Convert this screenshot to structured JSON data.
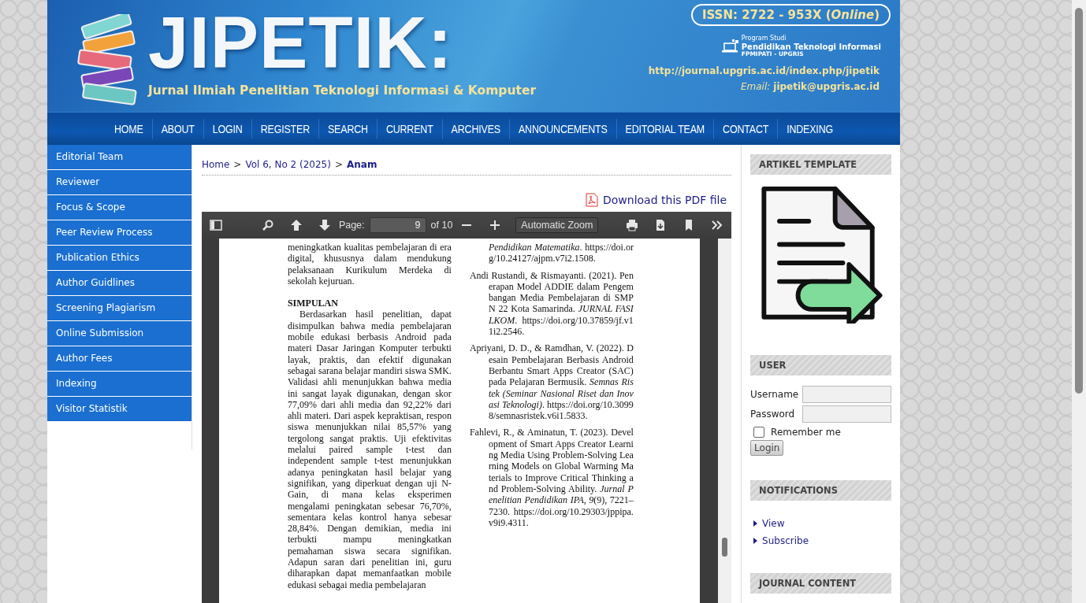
{
  "header": {
    "title": "JIPETIK:",
    "subtitle": "Jurnal Ilmiah Penelitian Teknologi Informasi & Komputer",
    "issn": "ISSN: 2722 - 953X (*Online*)",
    "program_label": "Program Studi",
    "program_name": "Pendidikan Teknologi Informasi",
    "faculty": "FPMIPATI - UPGRIS",
    "url": "http://journal.upgris.ac.id/index.php/jipetik",
    "email_label": "Email:",
    "email": "jipetik@upgris.ac.id"
  },
  "nav": [
    "HOME",
    "ABOUT",
    "LOGIN",
    "REGISTER",
    "SEARCH",
    "CURRENT",
    "ARCHIVES",
    "ANNOUNCEMENTS",
    "EDITORIAL TEAM",
    "CONTACT",
    "INDEXING"
  ],
  "sidebar": {
    "items": [
      "Editorial Team",
      "Reviewer",
      "Focus & Scope",
      "Peer Review Process",
      "Publication Ethics",
      "Author Guidlines",
      "Screening Plagiarism",
      "Online Submission",
      "Author Fees",
      "Indexing",
      "Visitor Statistik"
    ]
  },
  "breadcrumb": {
    "separator": ">",
    "items": [
      {
        "label": "Home",
        "current": false
      },
      {
        "label": "Vol 6, No 2 (2025)",
        "current": false
      },
      {
        "label": "Anam",
        "current": true
      }
    ]
  },
  "download": "Download this PDF file",
  "pdf_toolbar": {
    "page_label": "Page:",
    "page": "9",
    "total": "of 10",
    "zoom": "Automatic Zoom"
  },
  "pdf_page": {
    "left_column": [
      {
        "kind": "paragraph",
        "indent": false,
        "text": "meningkatkan kualitas pembelajaran di era digital, khususnya dalam mendukung pelaksanaan Kurikulum Merdeka di sekolah kejuruan."
      },
      {
        "kind": "heading",
        "text": "SIMPULAN"
      },
      {
        "kind": "paragraph",
        "indent": true,
        "text": "Berdasarkan hasil penelitian, dapat disimpulkan bahwa media pembelajaran mobile edukasi berbasis Android pada materi Dasar Jaringan Komputer terbukti layak, praktis, dan efektif digunakan sebagai sarana belajar mandiri siswa SMK. Validasi ahli menunjukkan bahwa media ini sangat layak digunakan, dengan skor 77,09% dari ahli media dan 92,22% dari ahli materi. Dari aspek kepraktisan, respon siswa menunjukkan nilai 85,57% yang tergolong sangat praktis. Uji efektivitas melalui paired sample t-test dan independent sample t-test menunjukkan adanya peningkatan hasil belajar yang signifikan, yang diperkuat dengan uji N-Gain, di mana kelas eksperimen mengalami peningkatan sebesar 76,70%, sementara kelas kontrol hanya sebesar 28,84%. Dengan demikian, media ini terbukti mampu meningkatkan pemahaman siswa secara signifikan. Adapun saran dari penelitian ini, guru diharapkan dapat memanfaatkan mobile edukasi sebagai media pembelajaran"
      }
    ],
    "references": [
      {
        "kind": "continuation",
        "text": "*Pendidikan Matematika*. https://doi.org/10.24127/ajpm.v7i2.1508."
      },
      {
        "kind": "entry",
        "text": "Andi Rustandi, & Rismayanti. (2021). Penerapan Model ADDIE dalam Pengembangan Media Pembelajaran di SMPN 22 Kota Samarinda. *JURNAL FASILKOM*. https://doi.org/10.37859/jf.v11i2.2546."
      },
      {
        "kind": "entry",
        "text": "Apriyani, D. D., & Ramdhan, V. (2022). Desain Pembelajaran Berbasis Android Berbantu Smart Apps Creator (SAC) pada Pelajaran Bermusik. *Semnas Ristek (Seminar Nasional Riset dan Inovasi Teknologi)*. https://doi.org/10.30998/semnasristek.v6i1.5833."
      },
      {
        "kind": "entry",
        "text": "Fahlevi, R., & Aminatun, T. (2023). Development of Smart Apps Creator Learning Media Using Problem-Solving Learning Models on Global Warming Materials to Improve Critical Thinking and Problem-Solving Ability. *Jurnal Penelitian Pendidikan IPA*, *9*(9), 7221–7230. https://doi.org/10.29303/jppipa.v9i9.4311."
      }
    ]
  },
  "right_sidebar": {
    "template_title": "ARTIKEL TEMPLATE",
    "user_title": "USER",
    "username_label": "Username",
    "password_label": "Password",
    "remember_label": "Remember me",
    "remember_checked": false,
    "login_button": "Login",
    "notifications_title": "NOTIFICATIONS",
    "notification_links": [
      "View",
      "Subscribe"
    ],
    "journal_content_title": "JOURNAL CONTENT"
  }
}
